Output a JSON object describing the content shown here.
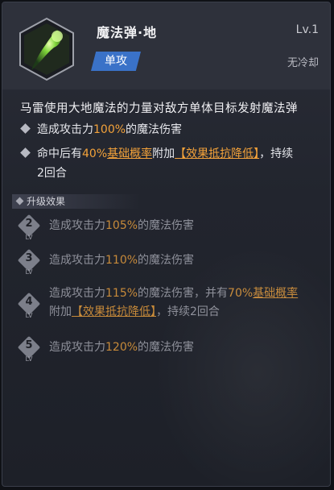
{
  "skill": {
    "name": "魔法弹·地",
    "level": "Lv.1",
    "tag": "单攻",
    "cooldown": "无冷却",
    "icon": "green-magic-bolt-icon"
  },
  "description": {
    "main": "马雷使用大地魔法的力量对敌方单体目标发射魔法弹",
    "bullet1": {
      "pre": "造成攻击力",
      "value": "100%",
      "post": "的魔法伤害"
    },
    "bullet2": {
      "pre": "命中后有",
      "value": "40%",
      "term": "基础概率",
      "mid": "附加",
      "effect": "【效果抵抗降低】",
      "post": "，持续",
      "line2": "2回合"
    }
  },
  "upgrades": {
    "title": "升级效果",
    "lv_label": "LV",
    "items": [
      {
        "level": "2",
        "pre": "造成攻击力",
        "value": "105%",
        "post": "的魔法伤害"
      },
      {
        "level": "3",
        "pre": "造成攻击力",
        "value": "110%",
        "post": "的魔法伤害"
      },
      {
        "level": "4",
        "pre": "造成攻击力",
        "value": "115%",
        "post": "的魔法伤害，并有",
        "value2": "70%",
        "term": "基础概率",
        "line2_pre": "附加",
        "effect": "【效果抵抗降低】",
        "line2_post": "，持续2回合"
      },
      {
        "level": "5",
        "pre": "造成攻击力",
        "value": "120%",
        "post": "的魔法伤害"
      }
    ]
  },
  "colors": {
    "accent": "#f3a23a",
    "tag": "#3a72c8",
    "muted": "#8e909a"
  }
}
